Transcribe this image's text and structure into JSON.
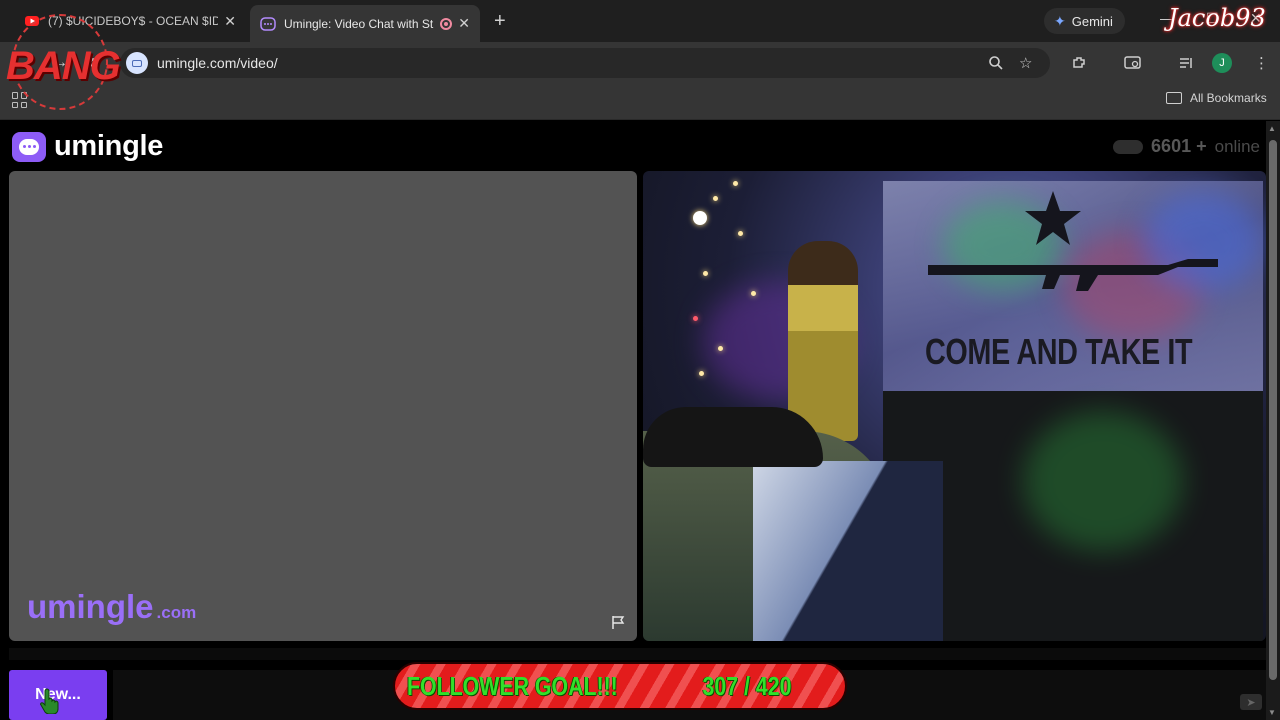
{
  "browser": {
    "tabs": [
      {
        "title": "(7) $UICIDEBOY$ - OCEAN $IDE",
        "active": false,
        "close": "✕"
      },
      {
        "title": "Umingle: Video Chat with St",
        "active": true,
        "close": "✕"
      }
    ],
    "new_tab_icon": "+",
    "gemini_label": "Gemini",
    "url": "umingle.com/video/",
    "profile_initial": "J",
    "bookmarks_label": "All Bookmarks"
  },
  "page": {
    "logo_text": "umingle",
    "online_count": "6601",
    "online_plus": "+",
    "online_label": "online",
    "brand_main": "umingle",
    "brand_suffix": ".com",
    "new_button_label": "New..."
  },
  "stream_overlay": {
    "bang_label": "BANG",
    "streamer_name": "Jacob93",
    "follower_goal_label": "FOLLOWER GOAL!!!",
    "follower_goal_count": "307 / 420",
    "webcam_banner_text": "COME AND TAKE IT"
  },
  "colors": {
    "accent": "#8d5cf6",
    "button": "#7a3ef0",
    "goal_bg": "#e31c1c",
    "goal_text": "#32e02a"
  },
  "icons": [
    "youtube-icon",
    "umingle-tab-icon",
    "recording-icon",
    "gemini-icon",
    "back-icon",
    "forward-icon",
    "reload-icon",
    "zoom-icon",
    "star-icon",
    "extensions-icon",
    "tab-search-icon",
    "media-icon",
    "apps-icon",
    "folder-icon",
    "flag-icon",
    "send-icon"
  ]
}
